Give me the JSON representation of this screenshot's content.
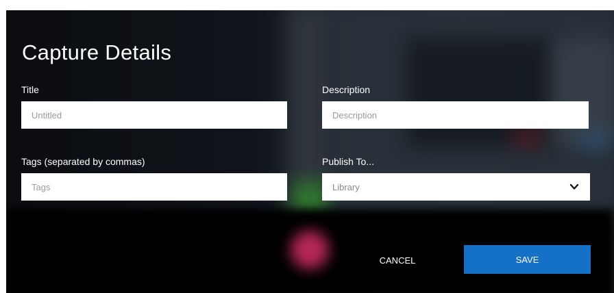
{
  "dialog": {
    "title": "Capture Details",
    "fields": {
      "title": {
        "label": "Title",
        "value": "",
        "placeholder": "Untitled"
      },
      "description": {
        "label": "Description",
        "value": "",
        "placeholder": "Description"
      },
      "tags": {
        "label": "Tags (separated by commas)",
        "value": "",
        "placeholder": "Tags"
      },
      "publish_to": {
        "label": "Publish To...",
        "selected": "Library"
      }
    },
    "buttons": {
      "cancel": "CANCEL",
      "save": "SAVE"
    }
  },
  "icons": {
    "dropdown": "chevron-down-icon"
  },
  "colors": {
    "dialog_bg": "#050607",
    "save_button": "#1471c5",
    "field_bg": "#ffffff"
  }
}
